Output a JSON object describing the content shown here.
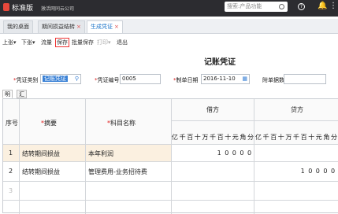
{
  "header": {
    "edition": "标准版",
    "company": "激活网同云公司",
    "search_placeholder": "搜索:产品功能",
    "help_icon": "?",
    "bell_icon": "🔔",
    "menu_icon": "⋮"
  },
  "tabs": [
    {
      "label": "我的桌面",
      "closable": false
    },
    {
      "label": "期间损益结转",
      "closable": true
    },
    {
      "label": "生成凭证",
      "closable": true,
      "active": true
    }
  ],
  "toolbar": {
    "up": "上张",
    "down": "下张",
    "flow": "流量",
    "save": "保存",
    "batch_save": "批量保存",
    "print": "打印",
    "exit": "退出",
    "dropdown": "▾"
  },
  "voucher": {
    "title": "记账凭证",
    "type_label": "凭证类别",
    "type_value": "记账凭证",
    "no_label": "凭证编号",
    "no_value": "0005",
    "date_label": "制单日期",
    "date_value": "2016-11-10",
    "attach_label": "附单据数",
    "attach_value": ""
  },
  "subtabs": [
    "明细",
    "汇总"
  ],
  "table": {
    "headers": {
      "seq": "序号",
      "summary": "摘要",
      "account": "科目名称",
      "debit": "借方",
      "credit": "贷方"
    },
    "units": [
      "亿",
      "千",
      "百",
      "十",
      "万",
      "千",
      "百",
      "十",
      "元",
      "角",
      "分"
    ],
    "rows": [
      {
        "seq": "1",
        "summary": "结转期间损益",
        "account": "本年利润",
        "debit": "10000",
        "credit": ""
      },
      {
        "seq": "2",
        "summary": "结转期间损益",
        "account": "管理费用-业务招待费",
        "debit": "",
        "credit": "10000"
      },
      {
        "seq": "3",
        "summary": "",
        "account": "",
        "debit": "",
        "credit": ""
      }
    ]
  },
  "colors": {
    "topbar": "#2c2c30",
    "accent": "#1a73c8",
    "required": "#e02020"
  }
}
